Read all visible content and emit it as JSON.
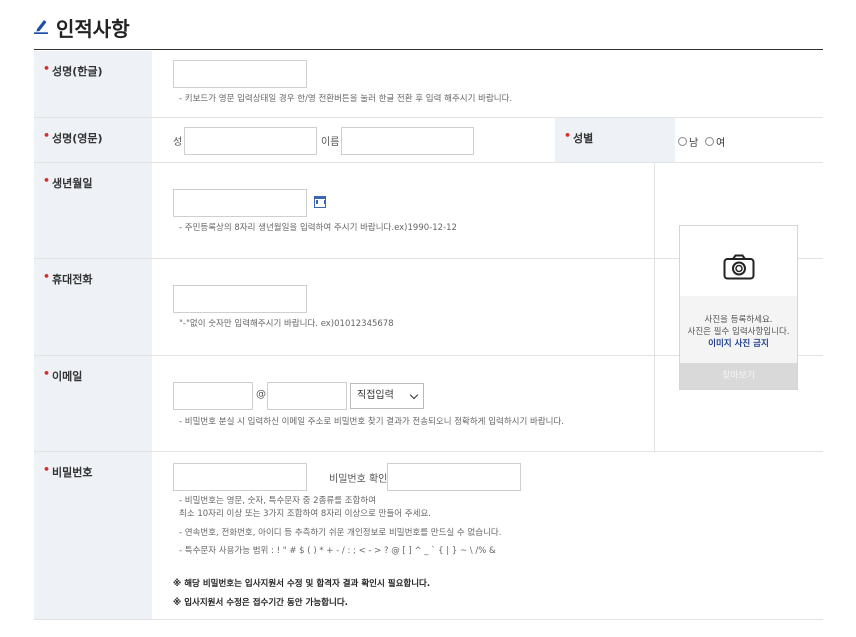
{
  "header": {
    "title": "인적사항"
  },
  "name_kr": {
    "label": "성명(한글)",
    "value": "",
    "help": "- 키보드가 영문 입력상태일 경우 한/영 전환버튼을 눌러 한글 전환 후 입력 해주시기 바랍니다."
  },
  "name_en": {
    "label": "성명(영문)",
    "last_label": "성",
    "first_label": "이름",
    "last_value": "",
    "first_value": ""
  },
  "gender": {
    "label": "성별",
    "options": [
      "남",
      "여"
    ]
  },
  "birth": {
    "label": "생년월일",
    "value": "",
    "help": "- 주민등록상의 8자리 생년월일을 입력하여 주시기 바랍니다.ex)1990-12-12"
  },
  "phone": {
    "label": "휴대전화",
    "value": "",
    "help": "\"-\"없이 숫자만 입력해주시기 바랍니다. ex)01012345678"
  },
  "email": {
    "label": "이메일",
    "local_value": "",
    "at": "@",
    "domain_value": "",
    "domain_select": "직접입력",
    "help": "- 비밀번호 분실 시 입력하신 이메일 주소로 비밀번호 찾기 결과가 전송되오니 정확하게 입력하시기 바랍니다."
  },
  "password": {
    "label": "비밀번호",
    "confirm_label": "비밀번호 확인",
    "help1": "- 비밀번호는 영문, 숫자, 특수문자 중 2종류를 조합하여",
    "help2": "최소 10자리 이상 또는 3가지 조합하여 8자리 이상으로 만들어 주세요.",
    "help3": "- 연속번호, 전화번호, 아이디 등 추측하기 쉬운 개인정보로 비밀번호를 만드실 수 없습니다.",
    "help4": "- 특수문자 사용가능 범위 : ! \" # $ ( ) * + - / : ; < - > ? @ [ ] ^ _ ` { | } ~ \\ /% &",
    "note1": "※ 해당 비밀번호는 입사지원서 수정 및 합격자 결과 확인시 필요합니다.",
    "note2": "※ 입사지원서 수정은 접수기간 동안 가능합니다."
  },
  "photo": {
    "line1": "사진을 등록하세요.",
    "line2": "사진은 필수 입력사항입니다.",
    "line3": "이미지 사진 금지",
    "button": "찾아보기",
    "icon": "camera-icon"
  }
}
